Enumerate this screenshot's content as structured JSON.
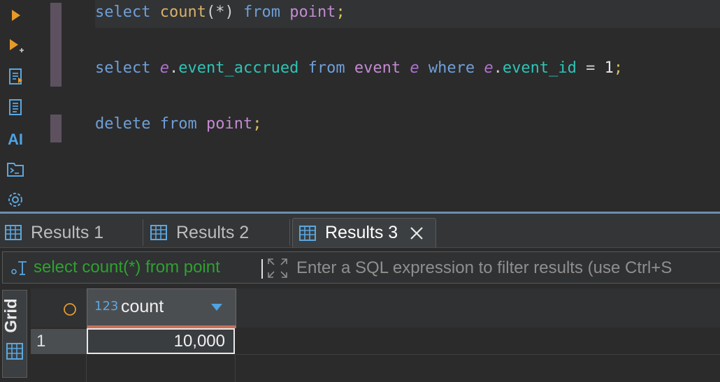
{
  "editor": {
    "lines": [
      {
        "tokens": [
          {
            "t": "select",
            "c": "kw"
          },
          {
            "t": " ",
            "c": ""
          },
          {
            "t": "count",
            "c": "fn"
          },
          {
            "t": "(*)",
            "c": "op"
          },
          {
            "t": " ",
            "c": ""
          },
          {
            "t": "from",
            "c": "kw"
          },
          {
            "t": " ",
            "c": ""
          },
          {
            "t": "point",
            "c": "tbl"
          },
          {
            "t": ";",
            "c": "pun"
          }
        ]
      },
      {
        "tokens": [
          {
            "t": "select",
            "c": "kw"
          },
          {
            "t": " ",
            "c": ""
          },
          {
            "t": "e",
            "c": "al"
          },
          {
            "t": ".",
            "c": "op"
          },
          {
            "t": "event_accrued",
            "c": "col"
          },
          {
            "t": " ",
            "c": ""
          },
          {
            "t": "from",
            "c": "kw"
          },
          {
            "t": " ",
            "c": ""
          },
          {
            "t": "event",
            "c": "tbl"
          },
          {
            "t": " ",
            "c": ""
          },
          {
            "t": "e",
            "c": "al"
          },
          {
            "t": " ",
            "c": ""
          },
          {
            "t": "where",
            "c": "kw"
          },
          {
            "t": " ",
            "c": ""
          },
          {
            "t": "e",
            "c": "al"
          },
          {
            "t": ".",
            "c": "op"
          },
          {
            "t": "event_id",
            "c": "col"
          },
          {
            "t": " = ",
            "c": "op"
          },
          {
            "t": "1",
            "c": "num"
          },
          {
            "t": ";",
            "c": "pun"
          }
        ]
      },
      {
        "tokens": [
          {
            "t": "delete",
            "c": "kw"
          },
          {
            "t": " ",
            "c": ""
          },
          {
            "t": "from",
            "c": "kw"
          },
          {
            "t": " ",
            "c": ""
          },
          {
            "t": "point",
            "c": "tbl"
          },
          {
            "t": ";",
            "c": "pun"
          }
        ]
      }
    ]
  },
  "toolbar": {
    "items": [
      "execute-icon",
      "execute-new-tab-icon",
      "execute-script-icon",
      "explain-plan-icon",
      "ai-assistant-icon",
      "terminal-icon",
      "settings-icon"
    ],
    "ai_label": "AI"
  },
  "results_tabs": [
    {
      "label": "Results 1",
      "active": false
    },
    {
      "label": "Results 2",
      "active": false
    },
    {
      "label": "Results 3",
      "active": true
    }
  ],
  "filter": {
    "query": "select count(*) from point",
    "placeholder": "Enter a SQL expression to filter results (use Ctrl+S"
  },
  "grid": {
    "view_tab": "Grid",
    "columns": [
      {
        "type_badge": "123",
        "name": "count"
      }
    ],
    "rows": [
      {
        "num": "1",
        "values": [
          "10,000"
        ]
      }
    ]
  },
  "colors": {
    "keyword": "#6f9fd8",
    "function": "#d9b169",
    "table": "#c38bd1",
    "column": "#2ec4b6",
    "filter_text": "#2fa12f"
  }
}
